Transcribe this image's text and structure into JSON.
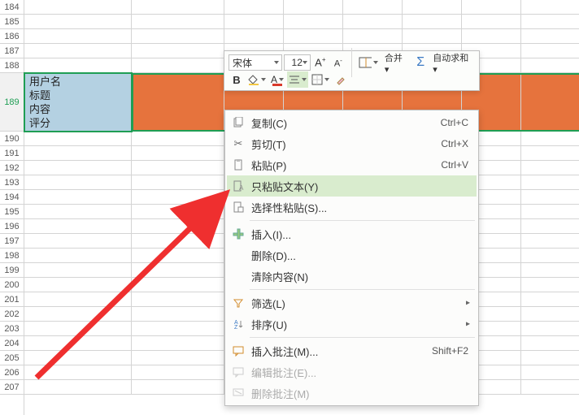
{
  "rows_before": [
    184,
    185,
    186,
    187,
    188
  ],
  "row_main": 189,
  "rows_after": [
    190,
    191,
    192,
    193,
    194,
    195,
    196,
    197,
    198,
    199,
    200,
    201,
    202,
    203,
    204,
    205,
    206,
    207
  ],
  "cell189_lines": [
    "用户名",
    "标题",
    "内容",
    "评分"
  ],
  "toolbar": {
    "font_name": "宋体",
    "font_size": "12",
    "bold_label": "B",
    "merge_label": "合并 ▾",
    "autosum_label": "自动求和 ▾"
  },
  "menu": {
    "copy": {
      "label": "复制(C)",
      "shortcut": "Ctrl+C"
    },
    "cut": {
      "label": "剪切(T)",
      "shortcut": "Ctrl+X"
    },
    "paste": {
      "label": "粘贴(P)",
      "shortcut": "Ctrl+V"
    },
    "paste_text": {
      "label": "只粘贴文本(Y)"
    },
    "paste_special": {
      "label": "选择性粘贴(S)..."
    },
    "insert": {
      "label": "插入(I)..."
    },
    "delete": {
      "label": "删除(D)..."
    },
    "clear": {
      "label": "清除内容(N)"
    },
    "filter": {
      "label": "筛选(L)"
    },
    "sort": {
      "label": "排序(U)"
    },
    "insert_comment": {
      "label": "插入批注(M)...",
      "shortcut": "Shift+F2"
    },
    "edit_comment": {
      "label": "编辑批注(E)..."
    },
    "delete_comment": {
      "label": "删除批注(M)"
    }
  }
}
